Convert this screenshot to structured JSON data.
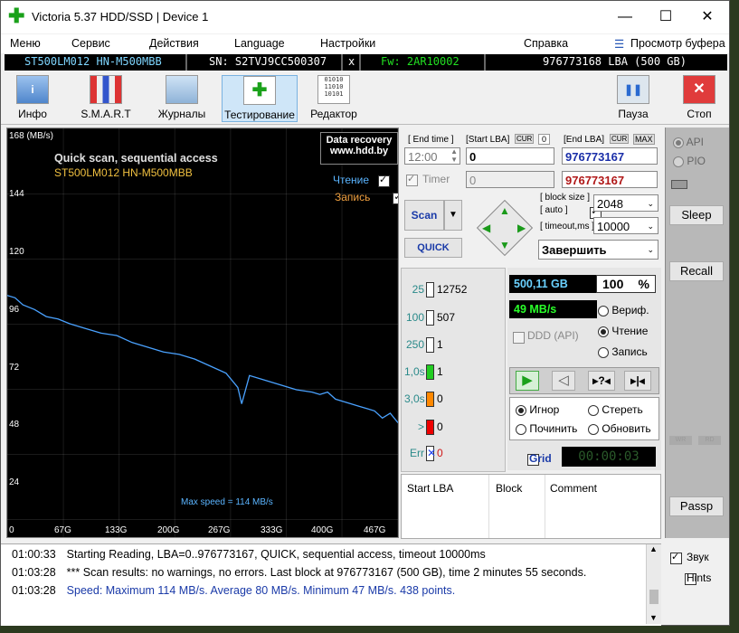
{
  "window": {
    "title": "Victoria 5.37 HDD/SSD | Device 1",
    "minimize": "—",
    "maximize": "☐",
    "close": "✕"
  },
  "menu": {
    "items": [
      "Меню",
      "Сервис",
      "Действия",
      "Language",
      "Настройки",
      "Справка"
    ],
    "buffer": "Просмотр буфера"
  },
  "info": {
    "model": "ST500LM012 HN-M500MBB",
    "sn": "SN: S2TVJ9CC500307",
    "x": "x",
    "fw": "Fw: 2AR10002",
    "lba": "976773168 LBA (500 GB)"
  },
  "toolbar": {
    "info": "Инфо",
    "smart": "S.M.A.R.T",
    "logs": "Журналы",
    "test": "Тестирование",
    "editor": "Редактор",
    "pause": "Пауза",
    "stop": "Стоп"
  },
  "graph": {
    "unit": "168 (MB/s)",
    "title": "Quick scan, sequential access",
    "model": "ST500LM012 HN-M500MBB",
    "banner1": "Data recovery",
    "banner2": "www.hdd.by",
    "read_label": "Чтение",
    "write_label": "Запись",
    "max_speed": "Max speed = 114 MB/s",
    "y_ticks": [
      "144",
      "120",
      "96",
      "72",
      "48",
      "24"
    ],
    "x_ticks": [
      "0",
      "67G",
      "133G",
      "200G",
      "267G",
      "333G",
      "400G",
      "467G"
    ]
  },
  "chart_data": {
    "type": "line",
    "ylabel": "(MB/s)",
    "ylim": [
      0,
      168
    ],
    "xlim": [
      0,
      500
    ],
    "x": [
      0,
      10,
      20,
      35,
      50,
      65,
      80,
      100,
      120,
      140,
      160,
      180,
      200,
      220,
      240,
      260,
      280,
      295,
      300,
      310,
      330,
      350,
      370,
      390,
      400,
      410,
      420,
      430,
      440,
      450,
      460,
      470,
      480,
      490,
      500
    ],
    "values": [
      101,
      100,
      97,
      95,
      92,
      91,
      89,
      87,
      85,
      84,
      81,
      79,
      77,
      76,
      74,
      71,
      68,
      62,
      55,
      67,
      65,
      63,
      61,
      60,
      59,
      60,
      57,
      56,
      55,
      54,
      53,
      52,
      49,
      51,
      47
    ]
  },
  "controls": {
    "end_time_label": "[ End time ]",
    "start_lba_label": "[Start LBA]",
    "cur1": "CUR",
    "zero": "0",
    "end_lba_label": "[End LBA]",
    "cur2": "CUR",
    "max": "MAX",
    "time_value": "12:00",
    "start_lba": "0",
    "end_lba": "976773167",
    "timer_label": "Timer",
    "timer_value": "0",
    "end_lba2": "976773167",
    "block_size_label": "[ block size ]",
    "auto_label": "[ auto ]",
    "block_size": "2048",
    "timeout_label": "[ timeout,ms ]",
    "timeout": "10000",
    "scan": "Scan",
    "quick": "QUICK",
    "finish": "Завершить"
  },
  "stats": {
    "rows": [
      {
        "t": "25",
        "n": "12752",
        "c": "#fff"
      },
      {
        "t": "100",
        "n": "507",
        "c": "#fff"
      },
      {
        "t": "250",
        "n": "1",
        "c": "#fff"
      },
      {
        "t": "1,0s",
        "n": "1",
        "c": "#22cc22"
      },
      {
        "t": "3,0s",
        "n": "0",
        "c": "#ff8800"
      },
      {
        "t": ">",
        "n": "0",
        "c": "#ee0000"
      },
      {
        "t": "Err",
        "n": "0",
        "c": "#2244ee"
      }
    ],
    "size": "500,11 GB",
    "percent": "100",
    "pct_sign": "%",
    "speed": "49 MB/s",
    "ddd": "DDD (API)",
    "verify": "Вериф.",
    "read": "Чтение",
    "write": "Запись",
    "ignore": "Игнор",
    "erase": "Стереть",
    "repair": "Починить",
    "update": "Обновить",
    "grid": "Grid",
    "timer": "00:00:03"
  },
  "table": {
    "headers": [
      "Start LBA",
      "Block",
      "Comment"
    ]
  },
  "right": {
    "api": "API",
    "pio": "PIO",
    "sleep": "Sleep",
    "recall": "Recall",
    "wr": "WR",
    "rd": "RD",
    "passp": "Passp"
  },
  "log": [
    {
      "time": "01:00:33",
      "text": "Starting Reading, LBA=0..976773167, QUICK, sequential access, timeout 10000ms",
      "color": "#000"
    },
    {
      "time": "01:03:28",
      "text": "*** Scan results: no warnings, no errors. Last block at 976773167 (500 GB), time 2 minutes 55 seconds.",
      "color": "#000"
    },
    {
      "time": "01:03:28",
      "text": "Speed: Maximum 114 MB/s. Average 80 MB/s. Minimum 47 MB/s. 438 points.",
      "color": "#1a3aa8"
    }
  ],
  "side": {
    "sound": "Звук",
    "hints": "Hints"
  }
}
